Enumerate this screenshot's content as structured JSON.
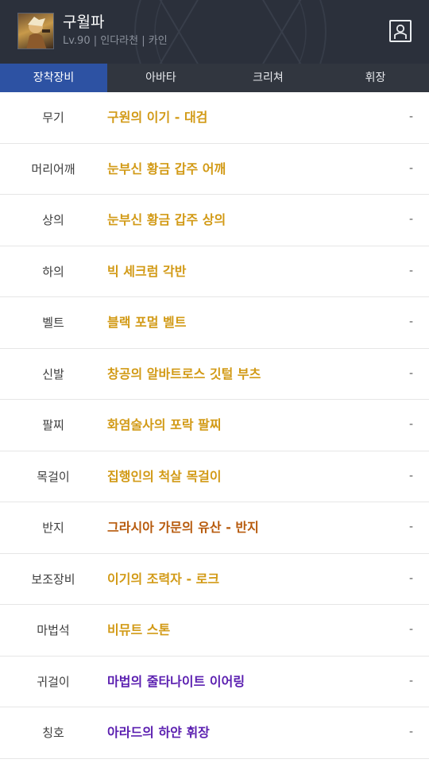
{
  "header": {
    "name": "구월파",
    "meta": "Lv.90 | 인다라천 | 카인"
  },
  "tabs": [
    {
      "label": "장착장비",
      "active": true
    },
    {
      "label": "아바타",
      "active": false
    },
    {
      "label": "크리쳐",
      "active": false
    },
    {
      "label": "휘장",
      "active": false
    }
  ],
  "equipment": [
    {
      "slot": "무기",
      "item": "구원의 이기 - 대검",
      "value": "-",
      "color": "#d29a16"
    },
    {
      "slot": "머리어깨",
      "item": "눈부신 황금 갑주 어깨",
      "value": "-",
      "color": "#d29a16"
    },
    {
      "slot": "상의",
      "item": "눈부신 황금 갑주 상의",
      "value": "-",
      "color": "#d29a16"
    },
    {
      "slot": "하의",
      "item": "빅 세크럼 각반",
      "value": "-",
      "color": "#d29a16"
    },
    {
      "slot": "벨트",
      "item": "블랙 포멀 벨트",
      "value": "-",
      "color": "#d29a16"
    },
    {
      "slot": "신발",
      "item": "창공의 알바트로스 깃털 부츠",
      "value": "-",
      "color": "#d29a16"
    },
    {
      "slot": "팔찌",
      "item": "화염술사의 포락 팔찌",
      "value": "-",
      "color": "#d29a16"
    },
    {
      "slot": "목걸이",
      "item": "집행인의 척살 목걸이",
      "value": "-",
      "color": "#d29a16"
    },
    {
      "slot": "반지",
      "item": "그라시아 가문의 유산 - 반지",
      "value": "-",
      "color": "#b75a0c"
    },
    {
      "slot": "보조장비",
      "item": "이기의 조력자 - 로크",
      "value": "-",
      "color": "#d29a16"
    },
    {
      "slot": "마법석",
      "item": "비뮤트 스톤",
      "value": "-",
      "color": "#d29a16"
    },
    {
      "slot": "귀걸이",
      "item": "마법의 줄타나이트 이어링",
      "value": "-",
      "color": "#5b1fb0"
    },
    {
      "slot": "칭호",
      "item": "아라드의 하얀 휘장",
      "value": "-",
      "color": "#5b1fb0"
    }
  ]
}
